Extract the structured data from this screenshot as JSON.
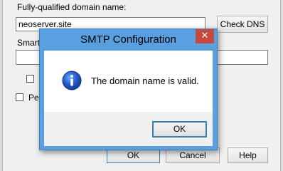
{
  "form": {
    "fqdn_label": "Fully-qualified domain name:",
    "fqdn_value": "neoserver.site",
    "check_dns_label": "Check DNS",
    "smart_host_label": "Smart h",
    "smart_host_value": "",
    "checkbox1_label": "",
    "checkbox2_label": "Per"
  },
  "footer": {
    "ok_label": "OK",
    "cancel_label": "Cancel",
    "help_label": "Help"
  },
  "dialog": {
    "title": "SMTP Configuration",
    "close_glyph": "✕",
    "message": "The domain name is valid.",
    "ok_label": "OK",
    "icon": "info-icon"
  }
}
